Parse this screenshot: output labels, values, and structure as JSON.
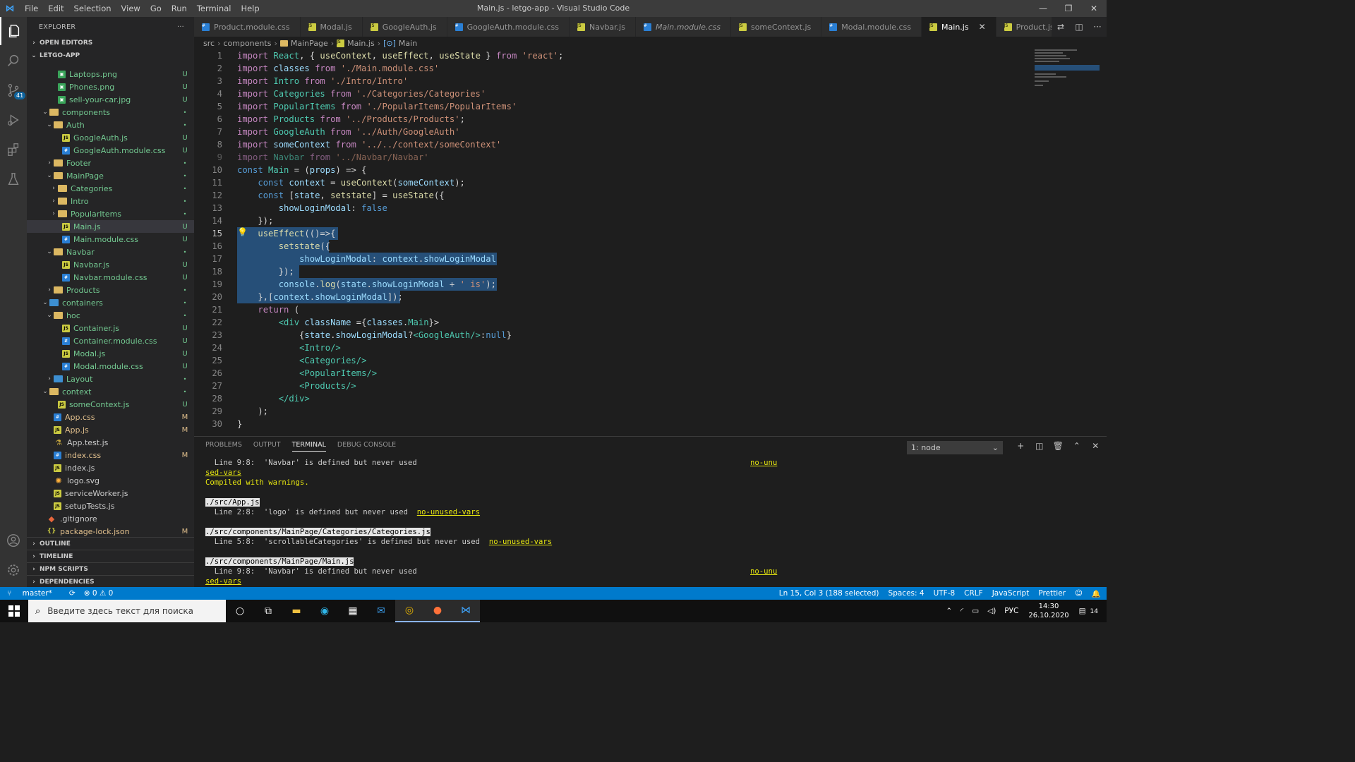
{
  "window": {
    "title": "Main.js - letgo-app - Visual Studio Code",
    "menu": [
      "File",
      "Edit",
      "Selection",
      "View",
      "Go",
      "Run",
      "Terminal",
      "Help"
    ]
  },
  "activity": {
    "scm_badge": "41"
  },
  "explorer": {
    "header": "EXPLORER",
    "more": "···",
    "open_editors": "OPEN EDITORS",
    "project": "LETGO-APP",
    "rows": [
      {
        "name": "Laptops.png",
        "status": "U"
      },
      {
        "name": "Phones.png",
        "status": "U"
      },
      {
        "name": "sell-your-car.jpg",
        "status": "U"
      },
      {
        "name": "components",
        "status": "•"
      },
      {
        "name": "Auth",
        "status": "•"
      },
      {
        "name": "GoogleAuth.js",
        "status": "U"
      },
      {
        "name": "GoogleAuth.module.css",
        "status": "U"
      },
      {
        "name": "Footer",
        "status": "•"
      },
      {
        "name": "MainPage",
        "status": "•"
      },
      {
        "name": "Categories",
        "status": "•"
      },
      {
        "name": "Intro",
        "status": "•"
      },
      {
        "name": "PopularItems",
        "status": "•"
      },
      {
        "name": "Main.js",
        "status": "U"
      },
      {
        "name": "Main.module.css",
        "status": "U"
      },
      {
        "name": "Navbar",
        "status": "•"
      },
      {
        "name": "Navbar.js",
        "status": "U"
      },
      {
        "name": "Navbar.module.css",
        "status": "U"
      },
      {
        "name": "Products",
        "status": "•"
      },
      {
        "name": "containers",
        "status": "•"
      },
      {
        "name": "hoc",
        "status": "•"
      },
      {
        "name": "Container.js",
        "status": "U"
      },
      {
        "name": "Container.module.css",
        "status": "U"
      },
      {
        "name": "Modal.js",
        "status": "U"
      },
      {
        "name": "Modal.module.css",
        "status": "U"
      },
      {
        "name": "Layout",
        "status": "•"
      },
      {
        "name": "context",
        "status": "•"
      },
      {
        "name": "someContext.js",
        "status": "U"
      },
      {
        "name": "App.css",
        "status": "M"
      },
      {
        "name": "App.js",
        "status": "M"
      },
      {
        "name": "App.test.js",
        "status": ""
      },
      {
        "name": "index.css",
        "status": "M"
      },
      {
        "name": "index.js",
        "status": ""
      },
      {
        "name": "logo.svg",
        "status": ""
      },
      {
        "name": "serviceWorker.js",
        "status": ""
      },
      {
        "name": "setupTests.js",
        "status": ""
      },
      {
        "name": ".gitignore",
        "status": ""
      },
      {
        "name": "package-lock.json",
        "status": "M"
      }
    ],
    "outline": "OUTLINE",
    "timeline": "TIMELINE",
    "npm_scripts": "NPM SCRIPTS",
    "dependencies": "DEPENDENCIES"
  },
  "tabs": [
    {
      "label": "Product.module.css"
    },
    {
      "label": "Modal.js"
    },
    {
      "label": "GoogleAuth.js"
    },
    {
      "label": "GoogleAuth.module.css"
    },
    {
      "label": "Navbar.js"
    },
    {
      "label": "Main.module.css"
    },
    {
      "label": "someContext.js"
    },
    {
      "label": "Modal.module.css"
    },
    {
      "label": "Main.js"
    },
    {
      "label": "Product.js"
    }
  ],
  "breadcrumb": [
    "src",
    "components",
    "MainPage",
    "Main.js",
    "Main"
  ],
  "editor": {
    "line_numbers": [
      "1",
      "2",
      "3",
      "4",
      "5",
      "6",
      "7",
      "8",
      "9",
      "10",
      "11",
      "12",
      "13",
      "14",
      "15",
      "16",
      "17",
      "18",
      "19",
      "20",
      "21",
      "22",
      "23",
      "24",
      "25",
      "26",
      "27",
      "28",
      "29",
      "30"
    ],
    "lines": [
      "import React, { useContext, useEffect, useState } from 'react';",
      "import classes from './Main.module.css'",
      "import Intro from './Intro/Intro'",
      "import Categories from './Categories/Categories'",
      "import PopularItems from './PopularItems/PopularItems'",
      "import Products from '../Products/Products';",
      "import GoogleAuth from '../Auth/GoogleAuth'",
      "import someContext from '../../context/someContext'",
      "import Navbar from '../Navbar/Navbar'",
      "const Main = (props) => {",
      "    const context = useContext(someContext);",
      "    const [state, setstate] = useState({",
      "        showLoginModal: false",
      "    });",
      "    useEffect(()=>{",
      "        setstate({",
      "            showLoginModal: context.showLoginModal",
      "        });",
      "        console.log(state.showLoginModal + ' is');",
      "    },[context.showLoginModal]);",
      "    return (",
      "        <div className ={classes.Main}>",
      "            {state.showLoginModal?<GoogleAuth/>:null}",
      "            <Intro/>",
      "            <Categories/>",
      "            <PopularItems/>",
      "            <Products/>",
      "        </div>",
      "    );",
      "}"
    ]
  },
  "panel": {
    "tabs": [
      "PROBLEMS",
      "OUTPUT",
      "TERMINAL",
      "DEBUG CONSOLE"
    ],
    "active_tab": "TERMINAL",
    "terminal_select": "1: node",
    "lines": {
      "l1": "  Line 9:8:  'Navbar' is defined but never used",
      "l1_rule": "no-unu",
      "l2": "sed-vars",
      "l3": "Compiled with warnings.",
      "l4": "./src/App.js",
      "l5a": "  Line 2:8:  'logo' is defined but never used  ",
      "l5b": "no-unused-vars",
      "l6": "./src/components/MainPage/Categories/Categories.js",
      "l7a": "  Line 5:8:  'scrollableCategories' is defined but never used  ",
      "l7b": "no-unused-vars",
      "l8": "./src/components/MainPage/Main.js",
      "l9": "  Line 9:8:  'Navbar' is defined but never used",
      "l9_rule": "no-unu",
      "l10": "sed-vars"
    }
  },
  "statusbar": {
    "branch": "master*",
    "errors": "⊗ 0 ⚠ 0",
    "position": "Ln 15, Col 3 (188 selected)",
    "spaces": "Spaces: 4",
    "encoding": "UTF-8",
    "eol": "CRLF",
    "language": "JavaScript",
    "formatter": "Prettier"
  },
  "taskbar": {
    "search_placeholder": "Введите здесь текст для поиска",
    "lang": "РУС",
    "time": "14:30",
    "date": "26.10.2020",
    "notifications": "14"
  }
}
